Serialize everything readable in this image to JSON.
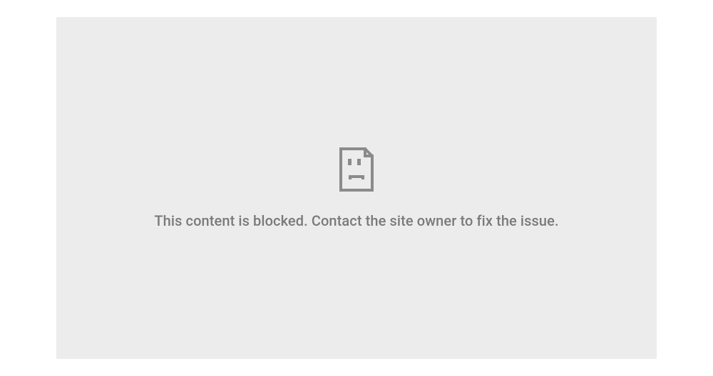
{
  "error": {
    "message": "This content is blocked. Contact the site owner to fix the issue.",
    "icon": "sad-page-icon"
  },
  "colors": {
    "panel_bg": "#ececec",
    "text": "#7a7a7a",
    "icon_stroke": "#8b8b8b"
  }
}
